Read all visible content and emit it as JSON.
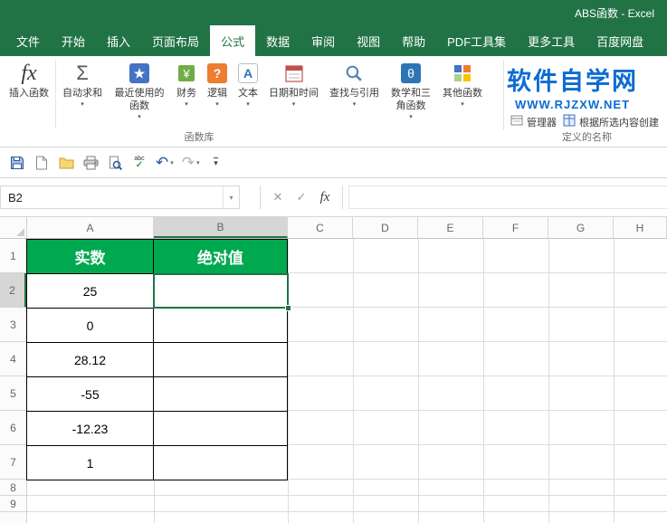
{
  "titlebar": {
    "title": "ABS函数 - Excel"
  },
  "tabs": [
    "文件",
    "开始",
    "插入",
    "页面布局",
    "公式",
    "数据",
    "审阅",
    "视图",
    "帮助",
    "PDF工具集",
    "更多工具",
    "百度网盘"
  ],
  "ribbon": {
    "insert_function": "插入函数",
    "autosum": "自动求和",
    "recent": "最近使用的函数",
    "financial": "财务",
    "logical": "逻辑",
    "text": "文本",
    "datetime": "日期和时间",
    "lookup": "查找与引用",
    "math_trig": "数学和三角函数",
    "more_functions": "其他函数",
    "group_function_library": "函数库",
    "name_manager": "管理器",
    "create_from_selection": "根据所选内容创建",
    "group_defined_names": "定义的名称"
  },
  "watermark": {
    "line1": "软件自学网",
    "line2": "WWW.RJZXW.NET"
  },
  "formula_bar": {
    "name_box": "B2",
    "formula": ""
  },
  "icons": {
    "fx": "fx",
    "sum": "Σ",
    "star": "★",
    "question": "?",
    "letter_a": "A",
    "theta": "θ",
    "close": "✕",
    "check": "✓",
    "undo": "↶",
    "redo": "↷",
    "small_arrow": "▾",
    "more": "▾"
  },
  "colors": {
    "brand_green": "#217346",
    "table_header_green": "#00A94F",
    "selection_green": "#217346",
    "watermark_blue": "#0B6CD4"
  },
  "sheet": {
    "col_headers": [
      "A",
      "B",
      "C",
      "D",
      "E",
      "F",
      "G",
      "H"
    ],
    "row_headers": [
      "1",
      "2",
      "3",
      "4",
      "5",
      "6",
      "7",
      "8",
      "9"
    ],
    "table_headers": [
      "实数",
      "绝对值"
    ],
    "values": [
      "25",
      "0",
      "28.12",
      "-55",
      "-12.23",
      "1"
    ],
    "selected_cell": "B2"
  }
}
